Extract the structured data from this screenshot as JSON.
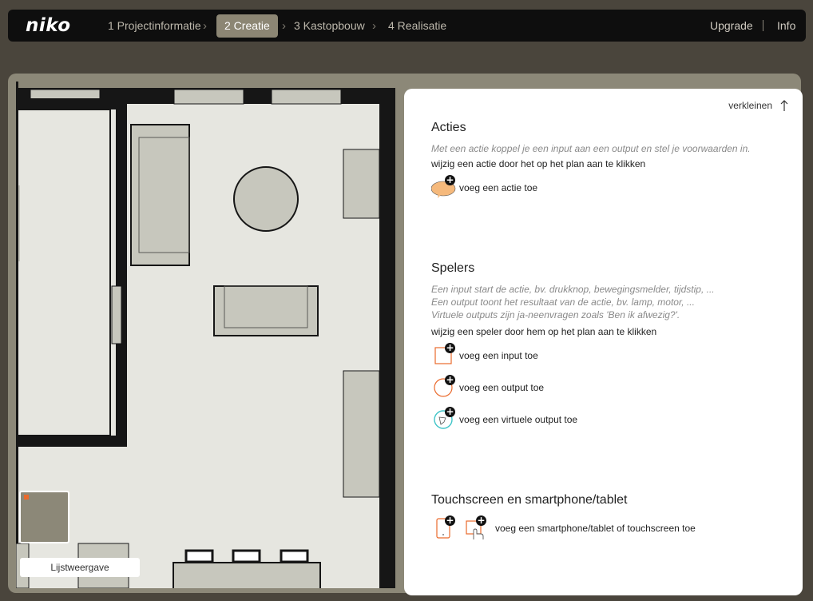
{
  "brand": {
    "logo_text": "niko"
  },
  "steps": [
    {
      "label": "1 Projectinformatie",
      "active": false
    },
    {
      "label": "2 Creatie",
      "active": true
    },
    {
      "label": "3 Kastopbouw",
      "active": false
    },
    {
      "label": "4 Realisatie",
      "active": false
    }
  ],
  "nav": {
    "upgrade": "Upgrade",
    "info": "Info"
  },
  "colors": {
    "accent": "#ea6a2c",
    "topbar": "#0e0e0e",
    "active_step": "#8c8674",
    "virtual_output": "#3fc4c8"
  },
  "plan": {
    "list_view_label": "Lijstweergave"
  },
  "panel": {
    "collapse_label": "verkleinen",
    "acties": {
      "title": "Acties",
      "desc": "Met een actie koppel je een input aan een output en stel je voorwaarden in.",
      "hint": "wijzig een actie door het op het plan aan te klikken",
      "add": "voeg een actie toe"
    },
    "spelers": {
      "title": "Spelers",
      "desc1": "Een input start de actie, bv. drukknop, bewegingsmelder, tijdstip, ...",
      "desc2": "Een output toont het resultaat van de actie, bv. lamp, motor, ...",
      "desc3": "Virtuele outputs zijn ja-neenvragen zoals 'Ben ik afwezig?'.",
      "hint": "wijzig een speler door hem op het plan aan te klikken",
      "add_input": "voeg een input toe",
      "add_output": "voeg een output toe",
      "add_virtual": "voeg een virtuele output toe"
    },
    "touch": {
      "title": "Touchscreen en smartphone/tablet",
      "add": "voeg een smartphone/tablet of touchscreen toe"
    }
  }
}
